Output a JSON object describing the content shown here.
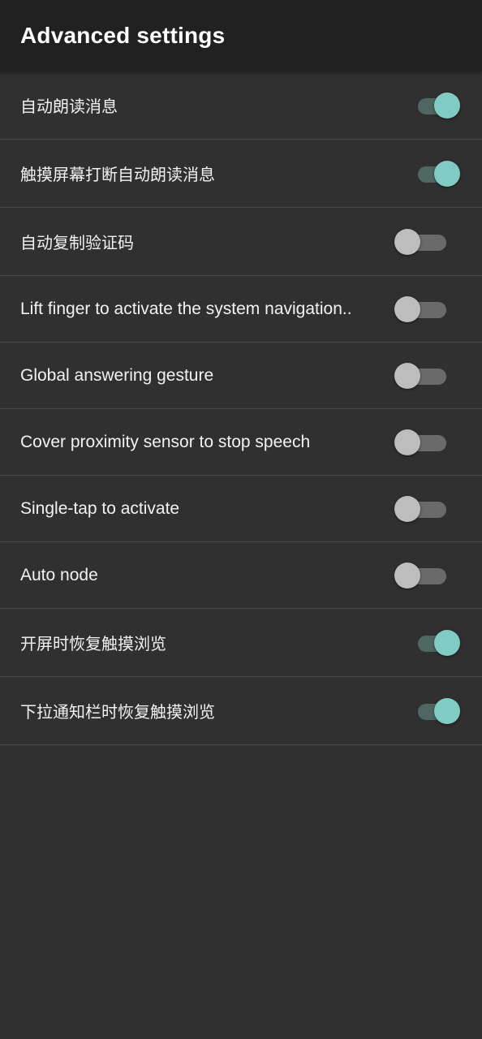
{
  "app_bar": {
    "title": "Advanced settings"
  },
  "settings": [
    {
      "label": "自动朗读消息",
      "enabled": true
    },
    {
      "label": "触摸屏幕打断自动朗读消息",
      "enabled": true
    },
    {
      "label": "自动复制验证码",
      "enabled": false
    },
    {
      "label": "Lift finger to activate the system navigation..",
      "enabled": false
    },
    {
      "label": "Global answering gesture",
      "enabled": false
    },
    {
      "label": "Cover proximity sensor to stop speech",
      "enabled": false
    },
    {
      "label": "Single-tap to activate",
      "enabled": false
    },
    {
      "label": "Auto node",
      "enabled": false
    },
    {
      "label": "开屏时恢复触摸浏览",
      "enabled": true
    },
    {
      "label": "下拉通知栏时恢复触摸浏览",
      "enabled": true
    }
  ],
  "colors": {
    "background": "#303030",
    "app_bar": "#212121",
    "accent_thumb": "#80cbc4",
    "accent_track": "#4e6762",
    "off_thumb": "#bdbdbd",
    "off_track": "#6a6a6a",
    "divider": "#474747"
  }
}
